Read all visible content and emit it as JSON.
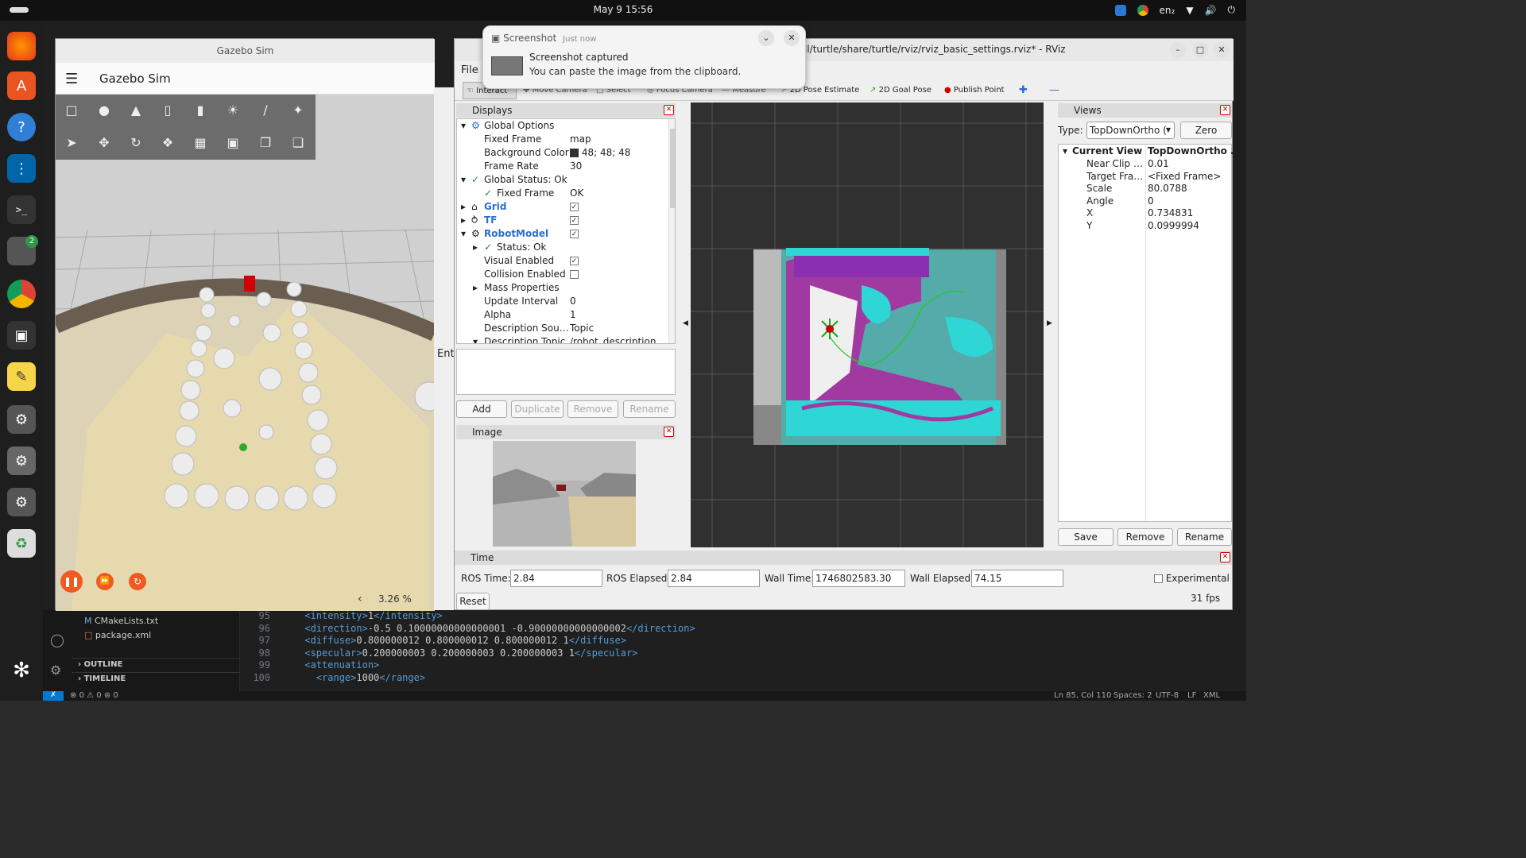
{
  "topbar": {
    "datetime": "May 9  15:56",
    "lang": "en₂"
  },
  "dock": {
    "badge": "2"
  },
  "gazebo": {
    "window_title": "Gazebo Sim",
    "app_title": "Gazebo Sim",
    "rtf": "3.26 %",
    "left_arrow": "‹"
  },
  "notification": {
    "app": "Screenshot",
    "time": "Just now",
    "title": "Screenshot captured",
    "body": "You can paste the image from the clipboard."
  },
  "rviz": {
    "title_path": "ll/turtle/share/turtle/rviz/rviz_basic_settings.rviz* - RViz",
    "menu_file": "File",
    "toolbar": [
      "Interact",
      "Move Camera",
      "Select",
      "Focus Camera",
      "Measure",
      "2D Pose Estimate",
      "2D Goal Pose",
      "Publish Point"
    ],
    "displays_title": "Displays",
    "displays": [
      {
        "key": "Global Options",
        "value": ""
      },
      {
        "key": "Fixed Frame",
        "value": "map"
      },
      {
        "key": "Background Color",
        "value": "48; 48; 48"
      },
      {
        "key": "Frame Rate",
        "value": "30"
      },
      {
        "key": "Global Status: Ok",
        "value": ""
      },
      {
        "key": "Fixed Frame",
        "value": "OK"
      },
      {
        "key": "Grid",
        "value": ""
      },
      {
        "key": "TF",
        "value": ""
      },
      {
        "key": "RobotModel",
        "value": ""
      },
      {
        "key": "Status: Ok",
        "value": ""
      },
      {
        "key": "Visual Enabled",
        "value": ""
      },
      {
        "key": "Collision Enabled",
        "value": ""
      },
      {
        "key": "Mass Properties",
        "value": ""
      },
      {
        "key": "Update Interval",
        "value": "0"
      },
      {
        "key": "Alpha",
        "value": "1"
      },
      {
        "key": "Description Sou…",
        "value": "Topic"
      },
      {
        "key": "Description Topic",
        "value": "/robot_description"
      }
    ],
    "buttons": {
      "add": "Add",
      "duplicate": "Duplicate",
      "remove": "Remove",
      "rename": "Rename"
    },
    "image_title": "Image",
    "views_title": "Views",
    "type_label": "Type:",
    "type_value": "TopDownOrtho (",
    "zero": "Zero",
    "current_view": {
      "key": "Current View",
      "value": "TopDownOrtho …"
    },
    "view_props": [
      {
        "key": "Near Clip …",
        "value": "0.01"
      },
      {
        "key": "Target Fra…",
        "value": "<Fixed Frame>"
      },
      {
        "key": "Scale",
        "value": "80.0788"
      },
      {
        "key": "Angle",
        "value": "0"
      },
      {
        "key": "X",
        "value": "0.734831"
      },
      {
        "key": "Y",
        "value": "0.0999994"
      }
    ],
    "views_buttons": {
      "save": "Save",
      "remove": "Remove",
      "rename": "Rename"
    },
    "time": {
      "title": "Time",
      "ros_time_label": "ROS Time:",
      "ros_time": "2.84",
      "ros_elapsed_label": "ROS Elapsed:",
      "ros_elapsed": "2.84",
      "wall_time_label": "Wall Time:",
      "wall_time": "1746802583.30",
      "wall_elapsed_label": "Wall Elapsed:",
      "wall_elapsed": "74.15",
      "experimental": "Experimental",
      "reset": "Reset",
      "fps": "31 fps"
    },
    "entity_label": "Ent"
  },
  "vscode": {
    "files": [
      "CMakeLists.txt",
      "package.xml"
    ],
    "outline": "OUTLINE",
    "timeline": "TIMELINE",
    "lines": [
      {
        "n": "95",
        "pre": "<intensity>",
        "mid": "1",
        "post": "</intensity>",
        "indent": "  "
      },
      {
        "n": "96",
        "pre": "<direction>",
        "mid": "-0.5 0.10000000000000001 -0.90000000000000002",
        "post": "</direction>",
        "indent": "  "
      },
      {
        "n": "97",
        "pre": "<diffuse>",
        "mid": "0.800000012 0.800000012 0.800000012 1",
        "post": "</diffuse>",
        "indent": "  "
      },
      {
        "n": "98",
        "pre": "<specular>",
        "mid": "0.200000003 0.200000003 0.200000003 1",
        "post": "</specular>",
        "indent": "  "
      },
      {
        "n": "99",
        "pre": "<attenuation>",
        "mid": "",
        "post": "",
        "indent": "  "
      },
      {
        "n": "100",
        "pre": "<range>",
        "mid": "1000",
        "post": "</range>",
        "indent": "    "
      }
    ],
    "status": {
      "errors": "0",
      "warnings": "0",
      "ports": "0",
      "cursor": "Ln 85, Col 110",
      "spaces": "Spaces: 2",
      "encoding": "UTF-8",
      "eol": "LF",
      "lang": "XML"
    }
  }
}
